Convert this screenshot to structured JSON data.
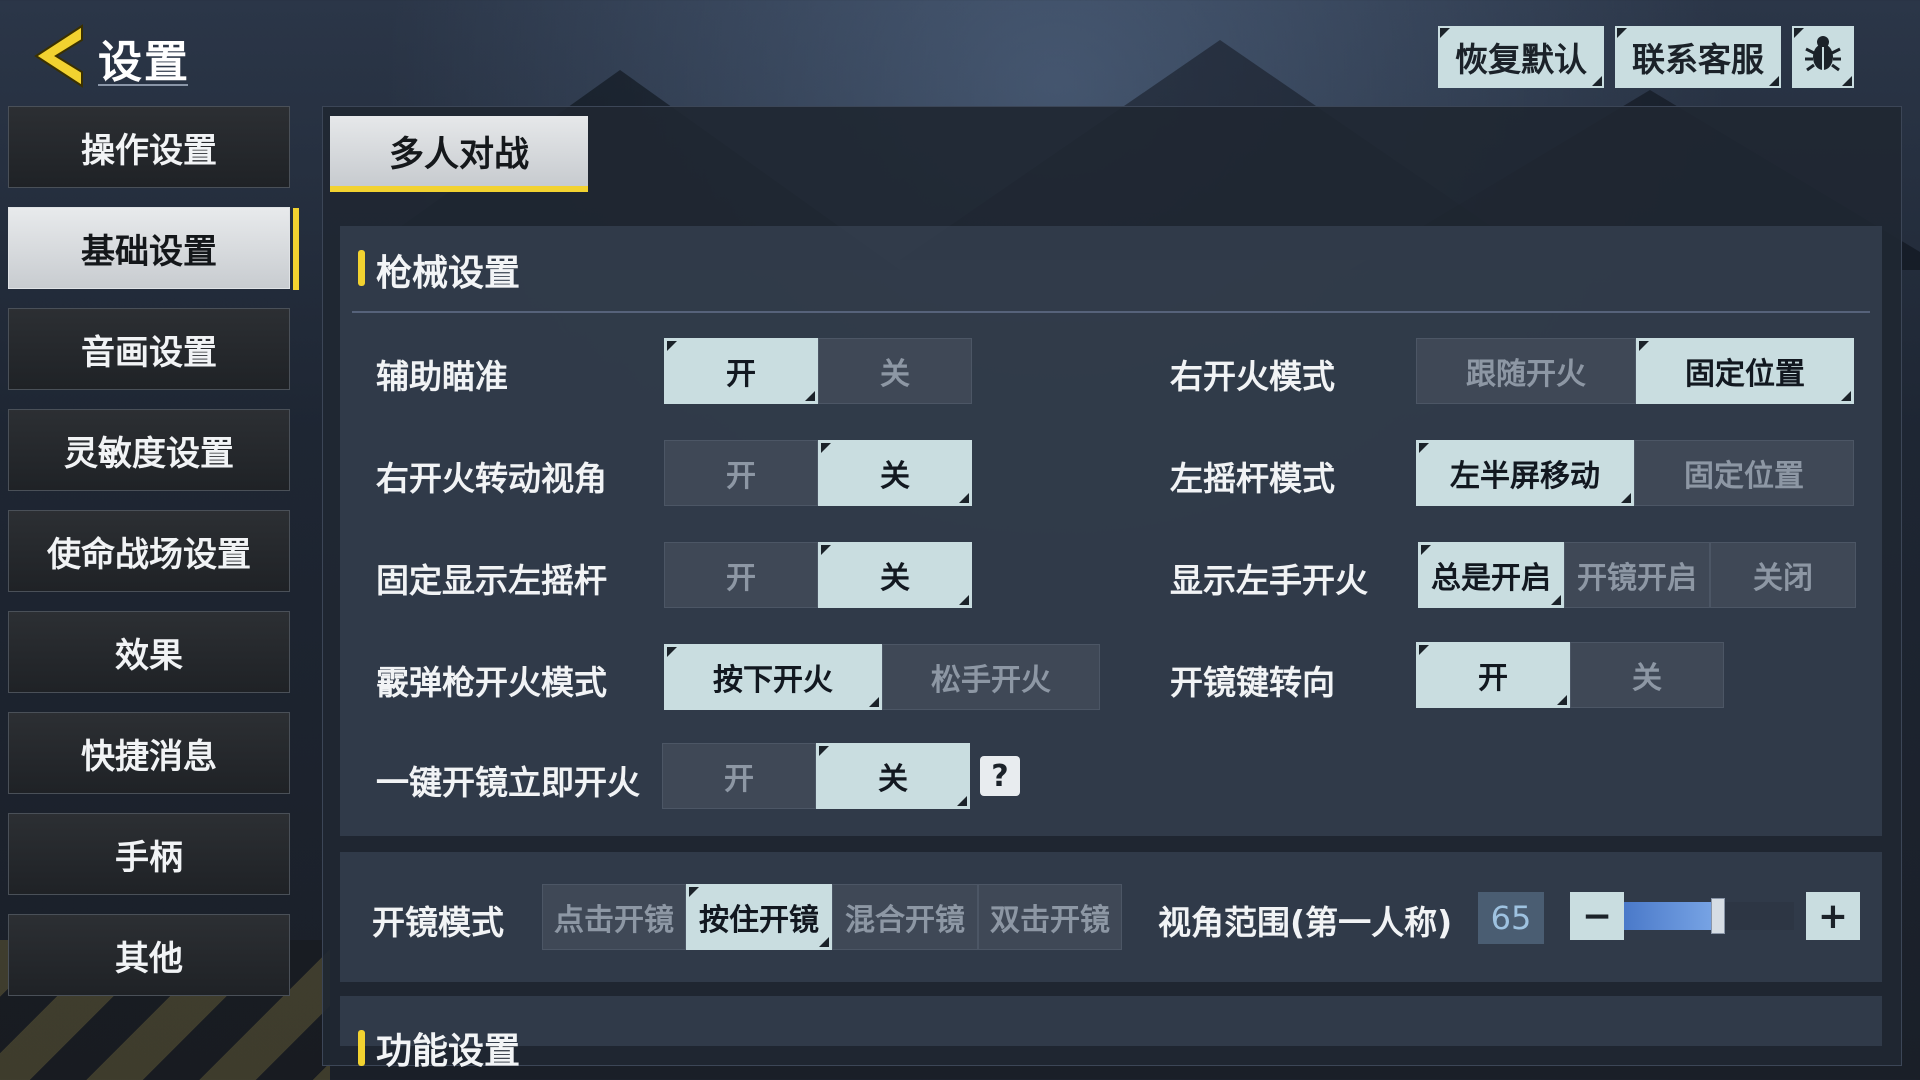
{
  "header": {
    "title": "设置",
    "buttons": {
      "reset": "恢复默认",
      "service": "联系客服"
    }
  },
  "sidebar": {
    "items": [
      {
        "label": "操作设置",
        "active": false
      },
      {
        "label": "基础设置",
        "active": true
      },
      {
        "label": "音画设置",
        "active": false
      },
      {
        "label": "灵敏度设置",
        "active": false
      },
      {
        "label": "使命战场设置",
        "active": false
      },
      {
        "label": "效果",
        "active": false
      },
      {
        "label": "快捷消息",
        "active": false
      },
      {
        "label": "手柄",
        "active": false
      },
      {
        "label": "其他",
        "active": false
      }
    ]
  },
  "tabs": [
    {
      "label": "多人对战",
      "active": true
    }
  ],
  "weapon_settings": {
    "title": "枪械设置",
    "rows": [
      {
        "label": "辅助瞄准",
        "options": [
          "开",
          "关"
        ],
        "selected": "开"
      },
      {
        "label": "右开火转动视角",
        "options": [
          "开",
          "关"
        ],
        "selected": "关"
      },
      {
        "label": "固定显示左摇杆",
        "options": [
          "开",
          "关"
        ],
        "selected": "关"
      },
      {
        "label": "霰弹枪开火模式",
        "options": [
          "按下开火",
          "松手开火"
        ],
        "selected": "按下开火"
      },
      {
        "label": "一键开镜立即开火",
        "options": [
          "开",
          "关"
        ],
        "selected": "关"
      },
      {
        "label": "右开火模式",
        "options": [
          "跟随开火",
          "固定位置"
        ],
        "selected": "固定位置"
      },
      {
        "label": "左摇杆模式",
        "options": [
          "左半屏移动",
          "固定位置"
        ],
        "selected": "左半屏移动"
      },
      {
        "label": "显示左手开火",
        "options": [
          "总是开启",
          "开镜开启",
          "关闭"
        ],
        "selected": "总是开启"
      },
      {
        "label": "开镜键转向",
        "options": [
          "开",
          "关"
        ],
        "selected": "开"
      }
    ],
    "help_icon": "?"
  },
  "scope": {
    "mode_label": "开镜模式",
    "mode_options": [
      "点击开镜",
      "按住开镜",
      "混合开镜",
      "双击开镜"
    ],
    "mode_selected": "按住开镜",
    "fov_label": "视角范围(第一人称)",
    "fov_value": "65",
    "fov_fraction": 0.55,
    "minus": "−",
    "plus": "+"
  },
  "function_settings": {
    "title": "功能设置"
  },
  "colors": {
    "accent_yellow": "#f2d230",
    "button_on": "#c9dde0",
    "button_off": "#3f4856",
    "slider_fill": "#5b8bd6"
  }
}
